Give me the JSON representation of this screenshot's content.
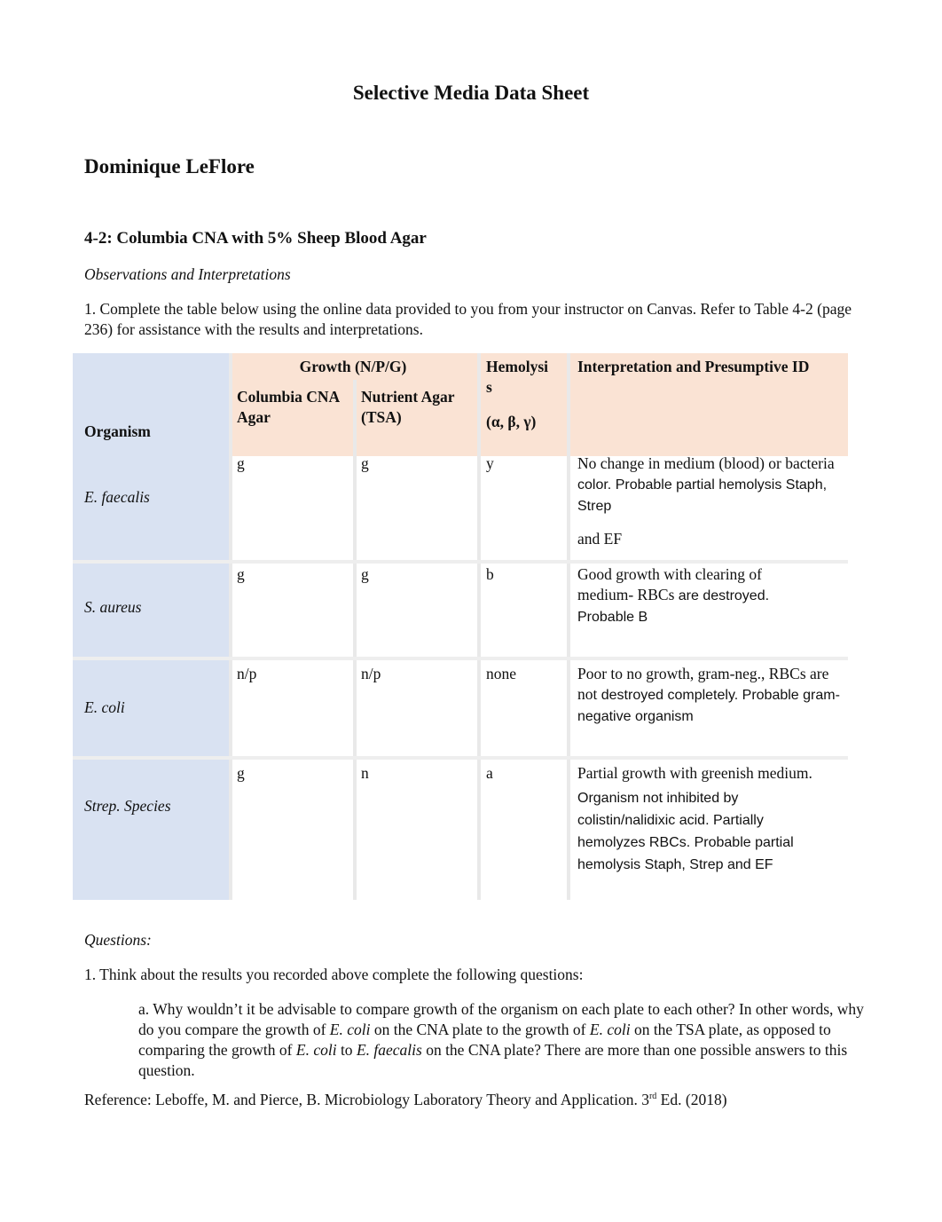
{
  "document": {
    "title": "Selective Media Data Sheet",
    "student_name": "Dominique LeFlore",
    "section_heading": "4-2: Columbia CNA with 5% Sheep Blood Agar",
    "observations_heading": "Observations and Interpretations",
    "instruction": "1. Complete the table below using the online data provided to you from your instructor on Canvas. Refer to Table 4-2 (page 236) for assistance with the results and interpretations."
  },
  "table": {
    "headers": {
      "organism": "Organism",
      "growth_group": "Growth (N/P/G)",
      "cna": "Columbia CNA Agar",
      "tsa": "Nutrient Agar (TSA)",
      "hemolysis_line1": "Hemolysi",
      "hemolysis_line2": "s",
      "hemolysis_symbols": "(α, β, γ)",
      "interpretation": "Interpretation and Presumptive ID"
    },
    "rows": [
      {
        "organism": "E. faecalis",
        "cna": "g",
        "tsa": "g",
        "hemolysis": "y",
        "interp_serif": "No change in medium (blood) or bacteria",
        "interp_sans": "color. Probable partial hemolysis Staph, Strep",
        "interp_extra": "and EF"
      },
      {
        "organism": "S. aureus",
        "cna": "g",
        "tsa": "g",
        "hemolysis": "b",
        "interp_serif": "Good growth with clearing of medium- RBCs",
        "interp_sans": "are destroyed. Probable B",
        "interp_extra": ""
      },
      {
        "organism": "E. coli",
        "cna": "n/p",
        "tsa": "n/p",
        "hemolysis": "none",
        "interp_serif": "Poor to no growth, gram-neg., RBCs are not",
        "interp_sans": "destroyed completely. Probable gram-negative organism",
        "interp_extra": ""
      },
      {
        "organism": "Strep. Species",
        "cna": "g",
        "tsa": "n",
        "hemolysis": "a",
        "interp_serif": "Partial growth with greenish medium.",
        "interp_sans": "Organism not inhibited by colistin/nalidixic acid. Partially hemolyzes RBCs. Probable partial hemolysis Staph, Strep and EF",
        "interp_extra": ""
      }
    ]
  },
  "questions": {
    "heading": "Questions:",
    "q1": "1. Think about the results you recorded above complete the following questions:",
    "qa_parts": {
      "p1": "a. Why wouldn’t it be advisable to compare growth of the organism on each plate to each other? In other words, why do you compare the growth of ",
      "ecoli1": "E. coli",
      "p2": " on the CNA plate to the growth of ",
      "ecoli2": "E. coli",
      "p3": " on the TSA plate, as opposed to comparing the growth of ",
      "ecoli3": "E. coli",
      "p4": " to ",
      "efaecalis": "E. faecalis",
      "p5": " on the CNA plate? There are more than one possible answers to this question."
    }
  },
  "reference": {
    "prefix": "Reference: Leboffe, M. and Pierce, B. Microbiology Laboratory Theory and Application. 3",
    "sup": "rd",
    "suffix": " Ed. (2018)"
  }
}
